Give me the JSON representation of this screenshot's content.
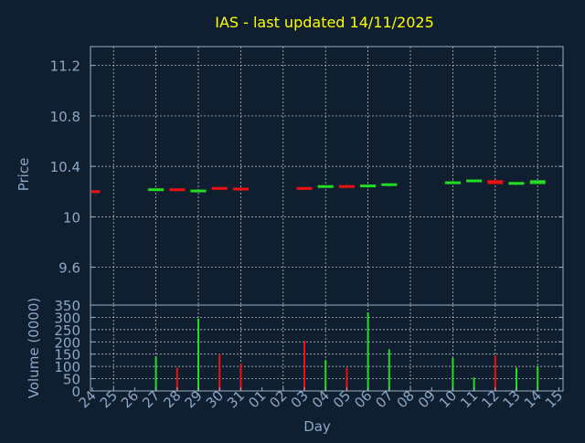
{
  "colors": {
    "background": "#0f1f2f",
    "frame": "#9ab0c8",
    "grid": "#c8d4e0",
    "text": "#8aa8c8",
    "title": "#ffff00",
    "up": "#22dd22",
    "down": "#ee1111"
  },
  "chart_data": [
    {
      "type": "candlestick",
      "title": "IAS - last updated 14/11/2025",
      "ylabel": "Price",
      "xlabel": "Day",
      "ylim": [
        9.3,
        11.35
      ],
      "yticks": [
        {
          "value": 9.6,
          "label": "9.6"
        },
        {
          "value": 10,
          "label": "10"
        },
        {
          "value": 10.4,
          "label": "10.4"
        },
        {
          "value": 10.8,
          "label": "10.8"
        },
        {
          "value": 11.2,
          "label": "11.2"
        }
      ],
      "days": [
        "24",
        "25",
        "26",
        "27",
        "28",
        "29",
        "30",
        "31",
        "01",
        "02",
        "03",
        "04",
        "05",
        "06",
        "07",
        "08",
        "09",
        "10",
        "11",
        "12",
        "13",
        "14",
        "15"
      ],
      "grid": true,
      "candles": [
        {
          "day": "24",
          "open": 10.21,
          "close": 10.19,
          "high": 10.21,
          "low": 10.19
        },
        {
          "day": "27",
          "open": 10.21,
          "close": 10.22,
          "high": 10.22,
          "low": 10.21
        },
        {
          "day": "28",
          "open": 10.22,
          "close": 10.21,
          "high": 10.22,
          "low": 10.21
        },
        {
          "day": "29",
          "open": 10.2,
          "close": 10.21,
          "high": 10.21,
          "low": 10.2
        },
        {
          "day": "30",
          "open": 10.23,
          "close": 10.22,
          "high": 10.23,
          "low": 10.22
        },
        {
          "day": "31",
          "open": 10.23,
          "close": 10.21,
          "high": 10.23,
          "low": 10.21
        },
        {
          "day": "03",
          "open": 10.23,
          "close": 10.22,
          "high": 10.23,
          "low": 10.21
        },
        {
          "day": "04",
          "open": 10.23,
          "close": 10.25,
          "high": 10.25,
          "low": 10.23
        },
        {
          "day": "05",
          "open": 10.25,
          "close": 10.23,
          "high": 10.26,
          "low": 10.23
        },
        {
          "day": "06",
          "open": 10.24,
          "close": 10.25,
          "high": 10.25,
          "low": 10.23
        },
        {
          "day": "07",
          "open": 10.25,
          "close": 10.26,
          "high": 10.26,
          "low": 10.24
        },
        {
          "day": "10",
          "open": 10.26,
          "close": 10.28,
          "high": 10.29,
          "low": 10.26
        },
        {
          "day": "11",
          "open": 10.28,
          "close": 10.29,
          "high": 10.29,
          "low": 10.28
        },
        {
          "day": "12",
          "open": 10.29,
          "close": 10.26,
          "high": 10.29,
          "low": 10.26
        },
        {
          "day": "13",
          "open": 10.26,
          "close": 10.27,
          "high": 10.27,
          "low": 10.25
        },
        {
          "day": "14",
          "open": 10.26,
          "close": 10.29,
          "high": 10.29,
          "low": 10.26
        }
      ]
    },
    {
      "type": "bar",
      "ylabel": "Volume (0000)",
      "ylim": [
        0,
        350
      ],
      "yticks": [
        0,
        50,
        100,
        150,
        200,
        250,
        300,
        350
      ],
      "grid": true,
      "bars": [
        {
          "day": "27",
          "value": 140,
          "dir": "up"
        },
        {
          "day": "28",
          "value": 95,
          "dir": "down"
        },
        {
          "day": "29",
          "value": 295,
          "dir": "up"
        },
        {
          "day": "30",
          "value": 150,
          "dir": "down"
        },
        {
          "day": "31",
          "value": 110,
          "dir": "down"
        },
        {
          "day": "03",
          "value": 205,
          "dir": "down"
        },
        {
          "day": "04",
          "value": 125,
          "dir": "up"
        },
        {
          "day": "05",
          "value": 95,
          "dir": "down"
        },
        {
          "day": "06",
          "value": 320,
          "dir": "up"
        },
        {
          "day": "07",
          "value": 170,
          "dir": "up"
        },
        {
          "day": "10",
          "value": 135,
          "dir": "up"
        },
        {
          "day": "11",
          "value": 55,
          "dir": "up"
        },
        {
          "day": "12",
          "value": 145,
          "dir": "down"
        },
        {
          "day": "13",
          "value": 95,
          "dir": "up"
        },
        {
          "day": "14",
          "value": 100,
          "dir": "up"
        }
      ]
    }
  ]
}
